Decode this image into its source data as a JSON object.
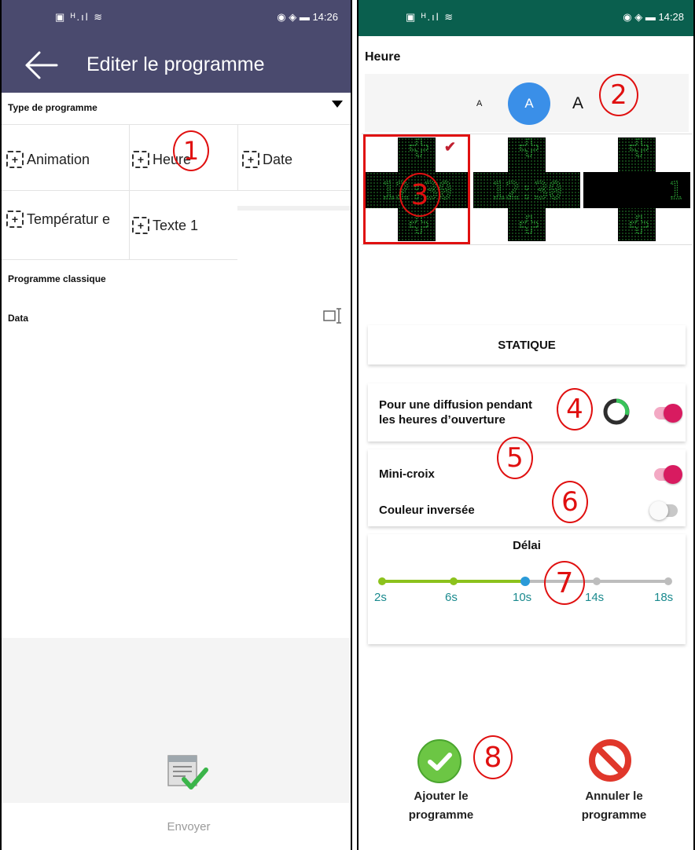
{
  "left": {
    "status_time": "14:26",
    "status_left_icons": "▣ ᴴ.ıl ≋",
    "status_right_icons": "◉ ◈ ▬",
    "title": "Editer le programme",
    "type_label": "Type de programme",
    "programs": [
      "Animation",
      "Heure",
      "Date",
      "Températur e",
      "Texte 1"
    ],
    "classic_label": "Programme classique",
    "data_label": "Data",
    "send_label": "Envoyer",
    "annotation": "1"
  },
  "right": {
    "status_time": "14:28",
    "status_left_icons": "▣ ᴴ.ıl ≋",
    "status_right_icons": "◉ ◈ ▬",
    "section_title": "Heure",
    "font_sizes": [
      "A",
      "A",
      "A"
    ],
    "preview_times": [
      "12:30",
      "12:30",
      "1"
    ],
    "statique_label": "STATIQUE",
    "opening_hours_label_1": "Pour une diffusion pendant",
    "opening_hours_label_2": "les heures d’ouverture",
    "mini_cross_label": "Mini-croix",
    "inverted_color_label": "Couleur inversée",
    "delay_title": "Délai",
    "delay_ticks": [
      "2s",
      "6s",
      "10s",
      "14s",
      "18s"
    ],
    "delay_selected": "10s",
    "toggles": {
      "opening_hours": true,
      "mini_cross": true,
      "inverted_color": false
    },
    "add_label_1": "Ajouter le",
    "add_label_2": "programme",
    "cancel_label_1": "Annuler le",
    "cancel_label_2": "programme",
    "annotations": [
      "2",
      "3",
      "4",
      "5",
      "6",
      "7",
      "8"
    ]
  },
  "colors": {
    "left_header": "#4a4a6e",
    "right_status": "#0a5f4e",
    "accent_blue": "#3a8fe8",
    "toggle_on": "#d81b60",
    "slider_active": "#8cc21c",
    "slider_inactive": "#bdbdbd",
    "tick_label": "#1a8a8e",
    "annotation_red": "#e01010",
    "led_green": "#2fae3a"
  }
}
